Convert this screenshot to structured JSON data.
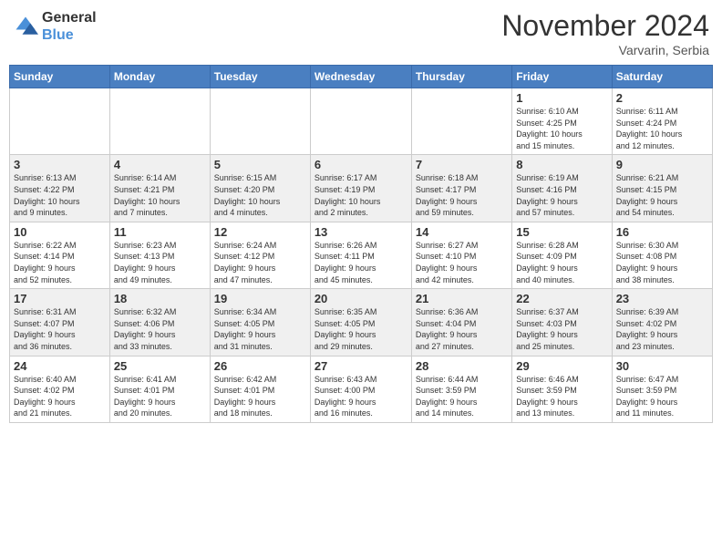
{
  "header": {
    "logo_general": "General",
    "logo_blue": "Blue",
    "month_title": "November 2024",
    "location": "Varvarin, Serbia"
  },
  "weekdays": [
    "Sunday",
    "Monday",
    "Tuesday",
    "Wednesday",
    "Thursday",
    "Friday",
    "Saturday"
  ],
  "rows": [
    {
      "cells": [
        {
          "day": "",
          "info": ""
        },
        {
          "day": "",
          "info": ""
        },
        {
          "day": "",
          "info": ""
        },
        {
          "day": "",
          "info": ""
        },
        {
          "day": "",
          "info": ""
        },
        {
          "day": "1",
          "info": "Sunrise: 6:10 AM\nSunset: 4:25 PM\nDaylight: 10 hours\nand 15 minutes."
        },
        {
          "day": "2",
          "info": "Sunrise: 6:11 AM\nSunset: 4:24 PM\nDaylight: 10 hours\nand 12 minutes."
        }
      ]
    },
    {
      "cells": [
        {
          "day": "3",
          "info": "Sunrise: 6:13 AM\nSunset: 4:22 PM\nDaylight: 10 hours\nand 9 minutes."
        },
        {
          "day": "4",
          "info": "Sunrise: 6:14 AM\nSunset: 4:21 PM\nDaylight: 10 hours\nand 7 minutes."
        },
        {
          "day": "5",
          "info": "Sunrise: 6:15 AM\nSunset: 4:20 PM\nDaylight: 10 hours\nand 4 minutes."
        },
        {
          "day": "6",
          "info": "Sunrise: 6:17 AM\nSunset: 4:19 PM\nDaylight: 10 hours\nand 2 minutes."
        },
        {
          "day": "7",
          "info": "Sunrise: 6:18 AM\nSunset: 4:17 PM\nDaylight: 9 hours\nand 59 minutes."
        },
        {
          "day": "8",
          "info": "Sunrise: 6:19 AM\nSunset: 4:16 PM\nDaylight: 9 hours\nand 57 minutes."
        },
        {
          "day": "9",
          "info": "Sunrise: 6:21 AM\nSunset: 4:15 PM\nDaylight: 9 hours\nand 54 minutes."
        }
      ]
    },
    {
      "cells": [
        {
          "day": "10",
          "info": "Sunrise: 6:22 AM\nSunset: 4:14 PM\nDaylight: 9 hours\nand 52 minutes."
        },
        {
          "day": "11",
          "info": "Sunrise: 6:23 AM\nSunset: 4:13 PM\nDaylight: 9 hours\nand 49 minutes."
        },
        {
          "day": "12",
          "info": "Sunrise: 6:24 AM\nSunset: 4:12 PM\nDaylight: 9 hours\nand 47 minutes."
        },
        {
          "day": "13",
          "info": "Sunrise: 6:26 AM\nSunset: 4:11 PM\nDaylight: 9 hours\nand 45 minutes."
        },
        {
          "day": "14",
          "info": "Sunrise: 6:27 AM\nSunset: 4:10 PM\nDaylight: 9 hours\nand 42 minutes."
        },
        {
          "day": "15",
          "info": "Sunrise: 6:28 AM\nSunset: 4:09 PM\nDaylight: 9 hours\nand 40 minutes."
        },
        {
          "day": "16",
          "info": "Sunrise: 6:30 AM\nSunset: 4:08 PM\nDaylight: 9 hours\nand 38 minutes."
        }
      ]
    },
    {
      "cells": [
        {
          "day": "17",
          "info": "Sunrise: 6:31 AM\nSunset: 4:07 PM\nDaylight: 9 hours\nand 36 minutes."
        },
        {
          "day": "18",
          "info": "Sunrise: 6:32 AM\nSunset: 4:06 PM\nDaylight: 9 hours\nand 33 minutes."
        },
        {
          "day": "19",
          "info": "Sunrise: 6:34 AM\nSunset: 4:05 PM\nDaylight: 9 hours\nand 31 minutes."
        },
        {
          "day": "20",
          "info": "Sunrise: 6:35 AM\nSunset: 4:05 PM\nDaylight: 9 hours\nand 29 minutes."
        },
        {
          "day": "21",
          "info": "Sunrise: 6:36 AM\nSunset: 4:04 PM\nDaylight: 9 hours\nand 27 minutes."
        },
        {
          "day": "22",
          "info": "Sunrise: 6:37 AM\nSunset: 4:03 PM\nDaylight: 9 hours\nand 25 minutes."
        },
        {
          "day": "23",
          "info": "Sunrise: 6:39 AM\nSunset: 4:02 PM\nDaylight: 9 hours\nand 23 minutes."
        }
      ]
    },
    {
      "cells": [
        {
          "day": "24",
          "info": "Sunrise: 6:40 AM\nSunset: 4:02 PM\nDaylight: 9 hours\nand 21 minutes."
        },
        {
          "day": "25",
          "info": "Sunrise: 6:41 AM\nSunset: 4:01 PM\nDaylight: 9 hours\nand 20 minutes."
        },
        {
          "day": "26",
          "info": "Sunrise: 6:42 AM\nSunset: 4:01 PM\nDaylight: 9 hours\nand 18 minutes."
        },
        {
          "day": "27",
          "info": "Sunrise: 6:43 AM\nSunset: 4:00 PM\nDaylight: 9 hours\nand 16 minutes."
        },
        {
          "day": "28",
          "info": "Sunrise: 6:44 AM\nSunset: 3:59 PM\nDaylight: 9 hours\nand 14 minutes."
        },
        {
          "day": "29",
          "info": "Sunrise: 6:46 AM\nSunset: 3:59 PM\nDaylight: 9 hours\nand 13 minutes."
        },
        {
          "day": "30",
          "info": "Sunrise: 6:47 AM\nSunset: 3:59 PM\nDaylight: 9 hours\nand 11 minutes."
        }
      ]
    }
  ]
}
